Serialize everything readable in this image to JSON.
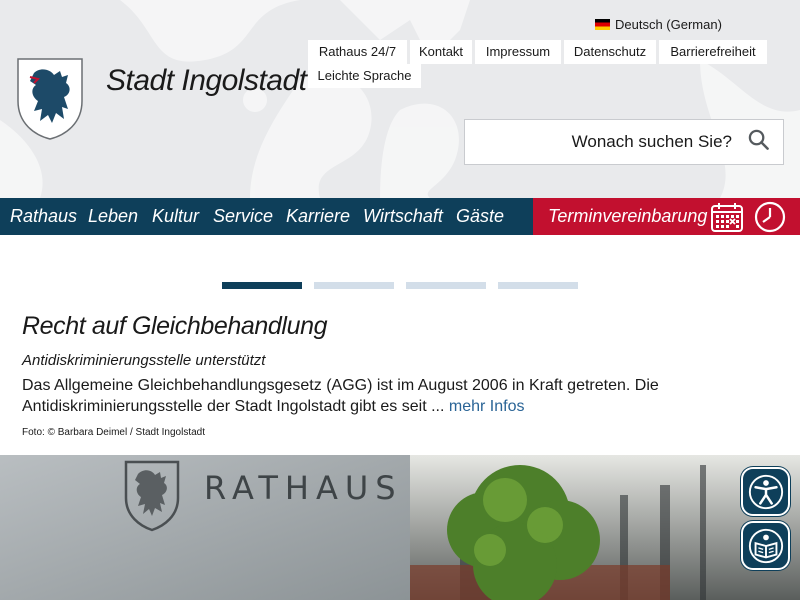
{
  "header": {
    "site_title": "Stadt Ingolstadt",
    "language": "Deutsch (German)",
    "utility_links": [
      "Rathaus 24/7",
      "Kontakt",
      "Impressum",
      "Datenschutz",
      "Barrierefreiheit",
      "Leichte Sprache"
    ],
    "search_placeholder": "Wonach suchen Sie?"
  },
  "nav": {
    "items": [
      "Rathaus",
      "Leben",
      "Kultur",
      "Service",
      "Karriere",
      "Wirtschaft",
      "Gäste"
    ],
    "appointment_label": "Terminvereinbarung"
  },
  "slider": {
    "slide_count": 4,
    "active_index": 0
  },
  "article": {
    "title": "Recht auf Gleichbehandlung",
    "subtitle": "Antidiskriminierungsstelle unterstützt",
    "body": "Das Allgemeine Gleichbehandlungsgesetz (AGG) ist im August 2006 in Kraft getreten. Die Antidiskriminierungsstelle der Stadt Ingolstadt gibt es seit ... ",
    "more_link": "mehr Infos",
    "photo_credit": "Foto: © Barbara Deimel / Stadt Ingolstadt"
  },
  "photo": {
    "sign_text": "RATHAUS"
  },
  "icons": {
    "logo": "coat-of-arms-panther",
    "language_flag": "germany-flag-icon",
    "search": "magnifier-icon",
    "calendar": "calendar-icon",
    "clock": "clock-icon",
    "accessibility": "accessibility-person-icon",
    "easy_read": "easy-read-book-icon"
  },
  "colors": {
    "nav_blue": "#0e3f5a",
    "accent_red": "#c2102f",
    "link_blue": "#2a6496",
    "indicator_inactive": "#d3dee9"
  }
}
